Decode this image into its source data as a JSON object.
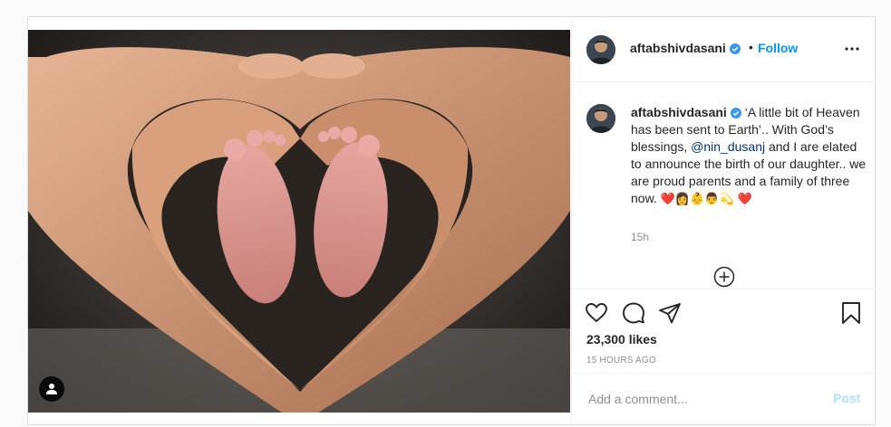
{
  "post": {
    "username": "aftabshivdasani",
    "follow_label": "Follow",
    "separator": "•",
    "caption": {
      "text_1": " ‘A little bit of Heaven has been sent to Earth’.. With God’s blessings, ",
      "mention": "@nin_dusanj",
      "text_2": " and I are elated to announce the birth of our daughter.. we are proud parents and a family of three now. ",
      "emojis": "❤️👩👶👨💫 ❤️"
    },
    "time_relative": "15h",
    "likes": "23,300 likes",
    "time_absolute": "15 HOURS AGO"
  },
  "comment": {
    "placeholder": "Add a comment...",
    "post_label": "Post"
  },
  "icons": {
    "verified": "verified-badge-icon",
    "more": "more-options-icon",
    "load_more": "plus-circle-icon",
    "like": "heart-icon",
    "comment": "comment-icon",
    "share": "share-icon",
    "save": "bookmark-icon",
    "tag": "user-tag-icon"
  },
  "colors": {
    "accent": "#0095f6",
    "verified": "#3897f0",
    "post_disabled": "#b2dffc",
    "muted": "#8e8e8e"
  }
}
